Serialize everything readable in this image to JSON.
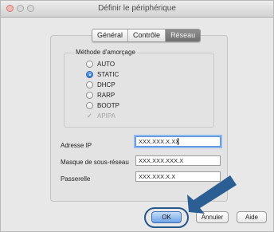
{
  "window": {
    "title": "Définir le périphérique"
  },
  "tabs": [
    "Général",
    "Contrôle",
    "Réseau"
  ],
  "active_tab_index": 2,
  "boot_method": {
    "title": "Méthode d'amorçage",
    "options": [
      {
        "label": "AUTO",
        "checked": false
      },
      {
        "label": "STATIC",
        "checked": true
      },
      {
        "label": "DHCP",
        "checked": false
      },
      {
        "label": "RARP",
        "checked": false
      },
      {
        "label": "BOOTP",
        "checked": false
      }
    ],
    "apipa": {
      "label": "APIPA",
      "checked": true,
      "disabled": true
    }
  },
  "fields": {
    "ip": {
      "label": "Adresse IP",
      "value": "XXX.XXX.X.XX"
    },
    "subnet": {
      "label": "Masque de sous-réseau",
      "value": "XXX.XXX.XXX.X"
    },
    "gateway": {
      "label": "Passerelle",
      "value": "XXX.XXX.X.X"
    }
  },
  "buttons": {
    "ok": "OK",
    "cancel": "Annuler",
    "help": "Aide"
  },
  "colors": {
    "arrow": "#2b5f94",
    "accent": "#5b8ed8"
  }
}
